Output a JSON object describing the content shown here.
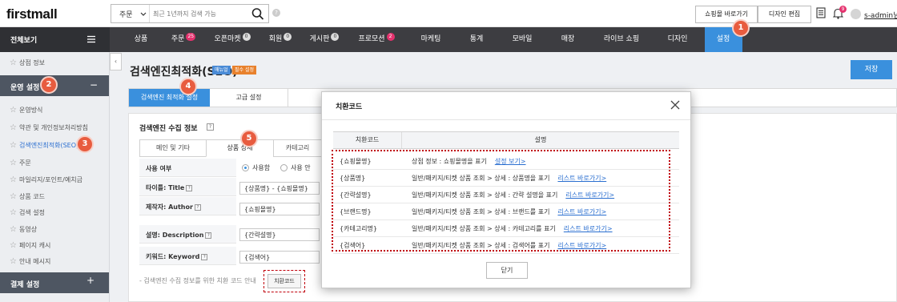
{
  "header": {
    "logo": "firstmall",
    "search": {
      "scope": "주문",
      "placeholder": "최근 1년까지 검색 가능"
    },
    "shop_button": "쇼핑몰 바로가기",
    "design_button": "디자인 편집",
    "notification_count": "9",
    "user_name": "s-admin님"
  },
  "nav": {
    "all_view": "전체보기",
    "items": [
      {
        "label": "상품",
        "badge": ""
      },
      {
        "label": "주문",
        "badge": "25"
      },
      {
        "label": "오픈마켓",
        "badge": "0"
      },
      {
        "label": "회원",
        "badge": "0"
      },
      {
        "label": "게시판",
        "badge": "0"
      },
      {
        "label": "프로모션",
        "badge": "2"
      },
      {
        "label": "마케팅",
        "badge": ""
      },
      {
        "label": "통계",
        "badge": ""
      },
      {
        "label": "모바일",
        "badge": ""
      },
      {
        "label": "매장",
        "badge": ""
      },
      {
        "label": "라이브 쇼핑",
        "badge": ""
      },
      {
        "label": "디자인",
        "badge": ""
      },
      {
        "label": "설정",
        "badge": ""
      }
    ],
    "active": "설정"
  },
  "steps": [
    "1",
    "2",
    "3",
    "4",
    "5"
  ],
  "sidebar": {
    "shop_info": "상점 정보",
    "section": "운영 설정",
    "items": [
      "운영방식",
      "약관 및 개인정보처리방침",
      "검색엔진최적화(SEO)",
      "주문",
      "마일리지/포인트/예치금",
      "상품 코드",
      "검색 설정",
      "동영상",
      "페이지 캐시",
      "안내 메시지"
    ],
    "active_item": "검색엔진최적화(SEO)",
    "payment": "결제 설정"
  },
  "page": {
    "title": "검색엔진최적화(SEO)",
    "manual_badge": "매뉴얼",
    "required_badge": "필수 설정",
    "save": "저장",
    "tabs": [
      "검색엔진 최적화 설정",
      "고급 설정"
    ],
    "section_title": "검색엔진 수집 정보",
    "sub_tabs": [
      "메인 및 기타",
      "상품 상세",
      "카테고리"
    ],
    "form": {
      "use_label": "사용 여부",
      "use_on": "사용함",
      "use_off": "사용 안",
      "title_label": "타이틀: Title",
      "title_value": "{상품명} - {쇼핑몰명}",
      "author_label": "제작자: Author",
      "author_value": "{쇼핑몰명}",
      "desc_label": "설명: Description",
      "desc_value": "{간략설명}",
      "keyword_label": "키워드: Keyword",
      "keyword_value": "{검색어}"
    },
    "footer_note": "- 검색엔진 수집 정보를 위한 치환 코드 안내",
    "code_button": "치환코드"
  },
  "modal": {
    "title": "치환코드",
    "headers": [
      "치환코드",
      "설명"
    ],
    "rows": [
      {
        "code": "{쇼핑몰명}",
        "desc": "상점 정보 : 쇼핑몰명을 표기",
        "link": "설정 보기>"
      },
      {
        "code": "{상품명}",
        "desc": "일반/패키지/티켓 상품 조회 > 상세 : 상품명을 표기",
        "link": "리스트 바로가기>"
      },
      {
        "code": "{간략설명}",
        "desc": "일반/패키지/티켓 상품 조회 > 상세 : 간략 설명을 표기",
        "link": "리스트 바로가기>"
      },
      {
        "code": "{브랜드명}",
        "desc": "일반/패키지/티켓 상품 조회 > 상세 : 브랜드를 표기",
        "link": "리스트 바로가기>"
      },
      {
        "code": "{카테고리명}",
        "desc": "일반/패키지/티켓 상품 조회 > 상세 : 카테고리를 표기",
        "link": "리스트 바로가기>"
      },
      {
        "code": "{검색어}",
        "desc": "일반/패키지/티켓 상품 조회 > 상세 : 검색어를 표기",
        "link": "리스트 바로가기>"
      }
    ],
    "close_button": "닫기"
  },
  "colors": {
    "accent": "#3a90dd",
    "nav_bg": "#3d3d41",
    "step": "#e85c3f",
    "badge": "#e5326e",
    "highlight": "#c0000b"
  }
}
